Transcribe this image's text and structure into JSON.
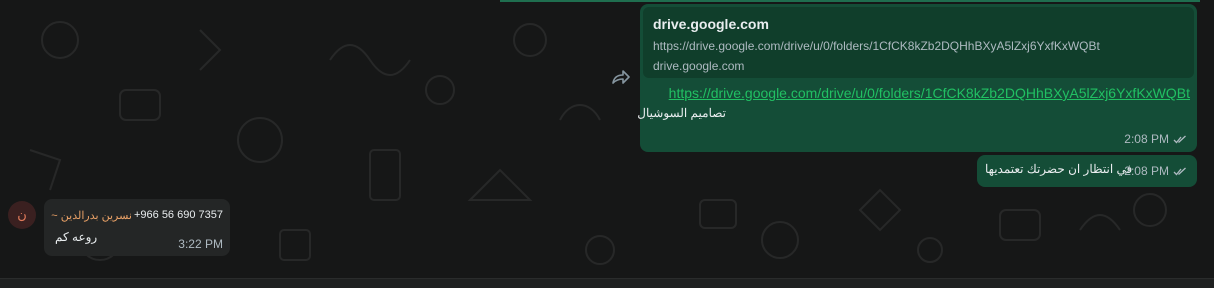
{
  "outgoing_1": {
    "preview_title": "drive.google.com",
    "preview_url": "https://drive.google.com/drive/u/0/folders/1CfCK8kZb2DQHhBXyA5lZxj6YxfKxWQBt",
    "preview_domain": "drive.google.com",
    "link_text": "https://drive.google.com/drive/u/0/folders/1CfCK8kZb2DQHhBXyA5lZxj6YxfKxWQBt",
    "caption": "تصاميم السوشيال",
    "time": "2:08 PM"
  },
  "outgoing_2": {
    "text": "في انتظار ان حضرتك تعتمديها",
    "time": "2:08 PM"
  },
  "incoming_1": {
    "avatar_letter": "ن",
    "sender_phone": "+966 56 690 7357",
    "sender_name": "~ نسرين بدرالدين",
    "text": "روعه كم",
    "time": "3:22 PM"
  },
  "colors": {
    "outgoing_bubble": "#144d37",
    "incoming_bubble": "#242626",
    "link": "#21c063",
    "sender_name": "#e8a066"
  }
}
